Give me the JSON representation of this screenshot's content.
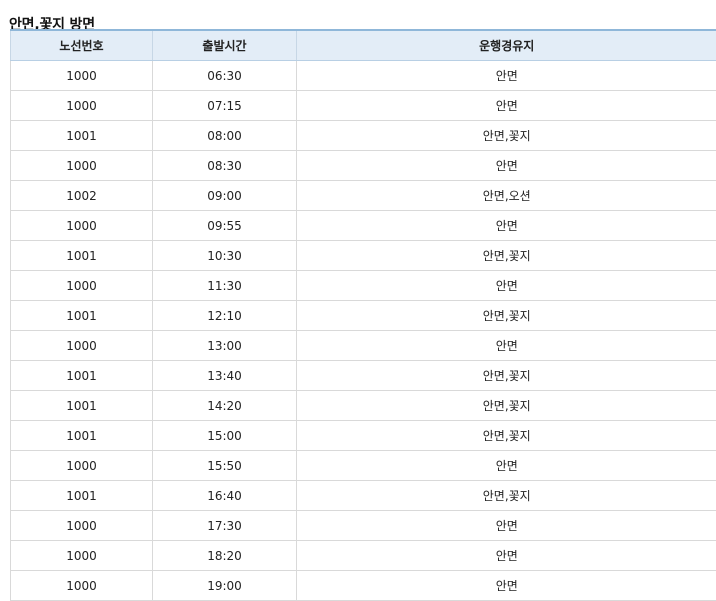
{
  "page": {
    "title": "안면,꽃지 방면"
  },
  "table": {
    "headers": [
      "노선번호",
      "출발시간",
      "운행경유지"
    ],
    "rows": [
      [
        "1000",
        "06:30",
        "안면"
      ],
      [
        "1000",
        "07:15",
        "안면"
      ],
      [
        "1001",
        "08:00",
        "안면,꽃지"
      ],
      [
        "1000",
        "08:30",
        "안면"
      ],
      [
        "1002",
        "09:00",
        "안면,오션"
      ],
      [
        "1000",
        "09:55",
        "안면"
      ],
      [
        "1001",
        "10:30",
        "안면,꽃지"
      ],
      [
        "1000",
        "11:30",
        "안면"
      ],
      [
        "1001",
        "12:10",
        "안면,꽃지"
      ],
      [
        "1000",
        "13:00",
        "안면"
      ],
      [
        "1001",
        "13:40",
        "안면,꽃지"
      ],
      [
        "1001",
        "14:20",
        "안면,꽃지"
      ],
      [
        "1001",
        "15:00",
        "안면,꽃지"
      ],
      [
        "1000",
        "15:50",
        "안면"
      ],
      [
        "1001",
        "16:40",
        "안면,꽃지"
      ],
      [
        "1000",
        "17:30",
        "안면"
      ],
      [
        "1000",
        "18:20",
        "안면"
      ],
      [
        "1000",
        "19:00",
        "안면"
      ]
    ]
  },
  "colors": {
    "header_bg": "#e3edf7",
    "header_top_border": "#8fb7d9",
    "row_border": "#d9d9d9"
  }
}
